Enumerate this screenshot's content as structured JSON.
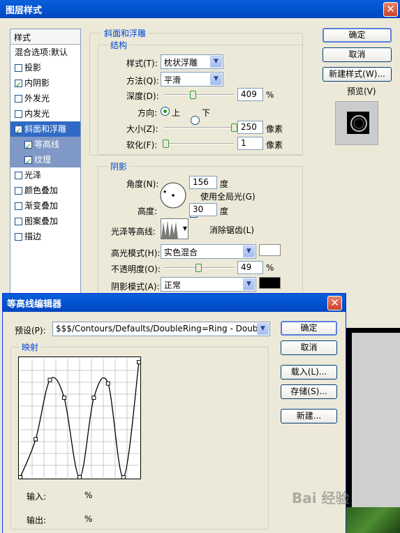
{
  "main_dialog": {
    "title": "图层样式",
    "styles_header": "样式",
    "list_items": [
      {
        "label": "混合选项:默认",
        "checkbox": false,
        "checked": false
      },
      {
        "label": "投影",
        "checkbox": true,
        "checked": false
      },
      {
        "label": "内阴影",
        "checkbox": true,
        "checked": true
      },
      {
        "label": "外发光",
        "checkbox": true,
        "checked": false
      },
      {
        "label": "内发光",
        "checkbox": true,
        "checked": false
      },
      {
        "label": "斜面和浮雕",
        "checkbox": true,
        "checked": true,
        "selected": true
      },
      {
        "label": "等高线",
        "checkbox": true,
        "checked": true,
        "sub": true
      },
      {
        "label": "纹理",
        "checkbox": true,
        "checked": true,
        "sub": true
      },
      {
        "label": "光泽",
        "checkbox": true,
        "checked": false
      },
      {
        "label": "颜色叠加",
        "checkbox": true,
        "checked": false
      },
      {
        "label": "渐变叠加",
        "checkbox": true,
        "checked": false
      },
      {
        "label": "图案叠加",
        "checkbox": true,
        "checked": false
      },
      {
        "label": "描边",
        "checkbox": true,
        "checked": false
      }
    ],
    "bevel": {
      "group_title": "斜面和浮雕",
      "structure_title": "结构",
      "style_label": "样式(T):",
      "style_value": "枕状浮雕",
      "technique_label": "方法(Q):",
      "technique_value": "平滑",
      "depth_label": "深度(D):",
      "depth_value": "409",
      "depth_unit": "%",
      "depth_level": 0.41,
      "direction_label": "方向:",
      "direction_up": "上",
      "direction_down": "下",
      "size_label": "大小(Z):",
      "size_value": "250",
      "size_unit": "像素",
      "size_level": 1.0,
      "soften_label": "软化(F):",
      "soften_value": "1",
      "soften_unit": "像素",
      "soften_level": 0.02
    },
    "shading": {
      "group_title": "阴影",
      "angle_label": "角度(N):",
      "angle_value": "156",
      "angle_unit": "度",
      "global_light_label": "使用全局光(G)",
      "altitude_label": "高度:",
      "altitude_value": "30",
      "altitude_unit": "度",
      "gloss_contour_label": "光泽等高线:",
      "antialias_label": "消除锯齿(L)",
      "highlight_mode_label": "高光模式(H):",
      "highlight_mode_value": "实色混合",
      "highlight_color": "#ffffff",
      "opacity_label": "不透明度(O):",
      "opacity_value": "49",
      "opacity_unit": "%",
      "opacity_level": 0.49,
      "shadow_mode_label": "阴影模式(A):",
      "shadow_mode_value": "正常",
      "shadow_color": "#000000"
    },
    "buttons": {
      "ok": "确定",
      "cancel": "取消",
      "new_style": "新建样式(W)...",
      "preview": "预览(V)"
    }
  },
  "contour_editor": {
    "title": "等高线编辑器",
    "preset_label": "预设(P):",
    "preset_value": "$$$/Contours/Defaults/DoubleRing=Ring - Double",
    "mapping_title": "映射",
    "input_label": "输入:",
    "input_unit": "%",
    "output_label": "输出:",
    "output_unit": "%",
    "buttons": {
      "ok": "确定",
      "cancel": "取消",
      "load": "载入(L)...",
      "save": "存储(S)...",
      "new": "新建..."
    },
    "curve_points": [
      {
        "input": 0,
        "output": 0
      },
      {
        "input": 13,
        "output": 32
      },
      {
        "input": 25,
        "output": 82
      },
      {
        "input": 37,
        "output": 67
      },
      {
        "input": 50,
        "output": 0
      },
      {
        "input": 62,
        "output": 67
      },
      {
        "input": 74,
        "output": 79
      },
      {
        "input": 87,
        "output": 0
      },
      {
        "input": 100,
        "output": 97
      }
    ]
  },
  "watermark": "Bai 经验"
}
